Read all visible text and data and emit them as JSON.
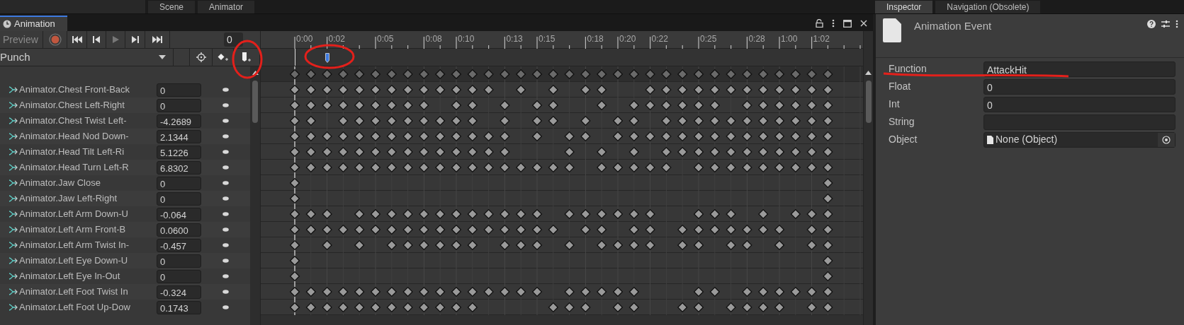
{
  "editor_tabs": [
    {
      "label": "Scene"
    },
    {
      "label": "Animator"
    }
  ],
  "inspector_tabs": [
    {
      "label": "Inspector"
    },
    {
      "label": "Navigation (Obsolete)"
    }
  ],
  "animation": {
    "title": "Animation",
    "preview": "Preview",
    "frame": "0",
    "clip": "Punch",
    "ruler": [
      {
        "label": "0:00"
      },
      {
        "label": "0:02"
      },
      {
        "label": "0:05"
      },
      {
        "label": "0:08"
      },
      {
        "label": "0:10"
      },
      {
        "label": "0:13"
      },
      {
        "label": "0:15"
      },
      {
        "label": "0:18"
      },
      {
        "label": "0:20"
      },
      {
        "label": "0:22"
      },
      {
        "label": "0:25"
      },
      {
        "label": "0:28"
      },
      {
        "label": "1:00"
      },
      {
        "label": "1:02"
      }
    ],
    "event_marker": {
      "selected": true
    },
    "properties": [
      {
        "name": "Animator.Chest Front-Back",
        "value": "0"
      },
      {
        "name": "Animator.Chest Left-Right",
        "value": "0"
      },
      {
        "name": "Animator.Chest Twist Left-",
        "value": "-4.2689"
      },
      {
        "name": "Animator.Head Nod Down-",
        "value": "2.1344"
      },
      {
        "name": "Animator.Head Tilt Left-Ri",
        "value": "5.1226"
      },
      {
        "name": "Animator.Head Turn Left-R",
        "value": "6.8302"
      },
      {
        "name": "Animator.Jaw Close",
        "value": "0"
      },
      {
        "name": "Animator.Jaw Left-Right",
        "value": "0"
      },
      {
        "name": "Animator.Left Arm Down-U",
        "value": "-0.064"
      },
      {
        "name": "Animator.Left Arm Front-B",
        "value": "0.0600"
      },
      {
        "name": "Animator.Left Arm Twist In-",
        "value": "-0.457"
      },
      {
        "name": "Animator.Left Eye Down-U",
        "value": "0"
      },
      {
        "name": "Animator.Left Eye In-Out",
        "value": "0"
      },
      {
        "name": "Animator.Left Foot Twist In",
        "value": "-0.324"
      },
      {
        "name": "Animator.Left Foot Up-Dow",
        "value": "0.1743"
      }
    ]
  },
  "inspector": {
    "title": "Animation Event",
    "fields": [
      {
        "kind": "text",
        "label": "Function",
        "value": "AttackHit"
      },
      {
        "kind": "text",
        "label": "Float",
        "value": "0"
      },
      {
        "kind": "text",
        "label": "Int",
        "value": "0"
      },
      {
        "kind": "text",
        "label": "String"
      },
      {
        "kind": "object",
        "label": "Object",
        "value": "None (Object)"
      }
    ]
  }
}
